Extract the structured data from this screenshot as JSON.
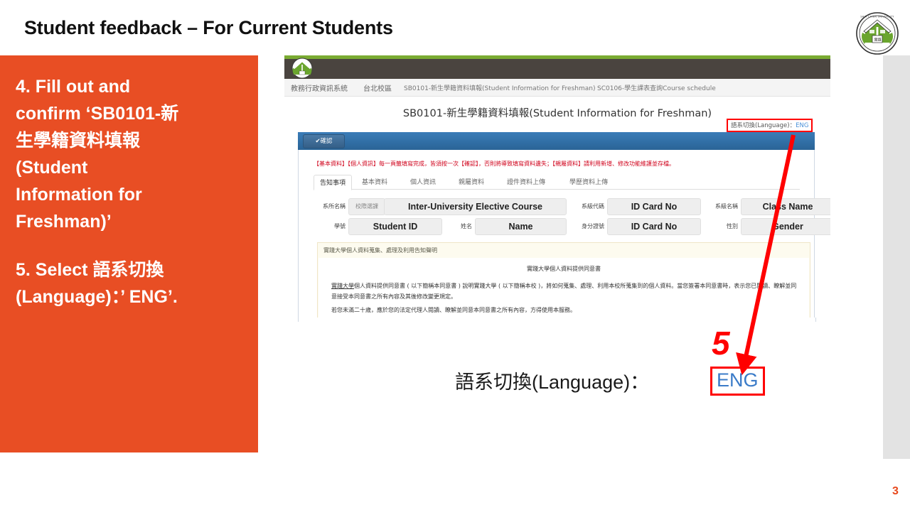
{
  "slide": {
    "title": "Student feedback – For Current Students",
    "page_number": "3",
    "accent_orange": "#e84e24",
    "annotation_red": "#ff0000"
  },
  "logo": {
    "name": "shih-chien-university-logo",
    "ring_text": "SHIH CHIEN UNIVERSITY"
  },
  "instructions": {
    "line1": "4. Fill out and",
    "line2": "confirm ‘SB0101-新",
    "line3": "生學籍資料填報",
    "line4": "(Student",
    "line5": "Information for",
    "line6": "Freshman)’",
    "line7": "5. Select 語系切換",
    "line8": "(Language)：’ ENG’."
  },
  "browser": {
    "nav_items": [
      "教務行政資訊系統",
      "台北校區",
      "SB0101-新生學籍資料填報(Student Information for Freshman)",
      "SC0106-學生課表查詢Course schedule"
    ],
    "page_heading": "SB0101-新生學籍資料填報(Student Information for Freshman)",
    "lang_switch": {
      "label": "語系切換(Language)：",
      "value": "ENG"
    },
    "confirm_button": "✔確認",
    "warning": "【基本資料】【個人資訊】每一頁籤填寫完成，皆須按一次【確認】，否則將導致填寫資料遺失；【親屬資料】請利用新增、修改功能維護並存檔。",
    "tabs": [
      "告知事項",
      "基本資料",
      "個人資訊",
      "親屬資料",
      "證件資料上傳",
      "學歷資料上傳"
    ],
    "active_tab": "告知事項",
    "fields_row1": [
      {
        "label": "系所名稱",
        "sub": "校際選課",
        "value": "Inter-University Elective Course"
      },
      {
        "label": "系級代碼",
        "value": "ID Card No"
      },
      {
        "label": "系級名稱",
        "value": "Class Name"
      }
    ],
    "fields_row2": [
      {
        "label": "學號",
        "value": "Student ID"
      },
      {
        "label": "姓名",
        "value": "Name"
      },
      {
        "label": "身分證號",
        "value": "ID Card No"
      },
      {
        "label": "性別",
        "value": "Gender"
      }
    ],
    "notice": {
      "header": "實踐大學個人資料蒐集、處理及利用告知聲明",
      "title": "實踐大學個人資料提供同意書",
      "paragraph1_underline": "實踐大學",
      "paragraph1": "個人資料提供同意書 ( 以下簡稱本同意書 ) 說明實踐大學 ( 以下簡稱本校 )，將如何蒐集、處理、利用本校所蒐集到的個人資料。當您簽署本同意書時，表示您已閱讀、瞭解並同意接受本同意書之所有內容及其後修改變更規定。",
      "paragraph2": "若您未滿二十歲，應於您的法定代理人閱讀、瞭解並同意本同意書之所有內容，方得使用本服務。"
    }
  },
  "annotation": {
    "step_number": "5",
    "callout_label": "語系切換(Language)：",
    "callout_value": "ENG"
  }
}
